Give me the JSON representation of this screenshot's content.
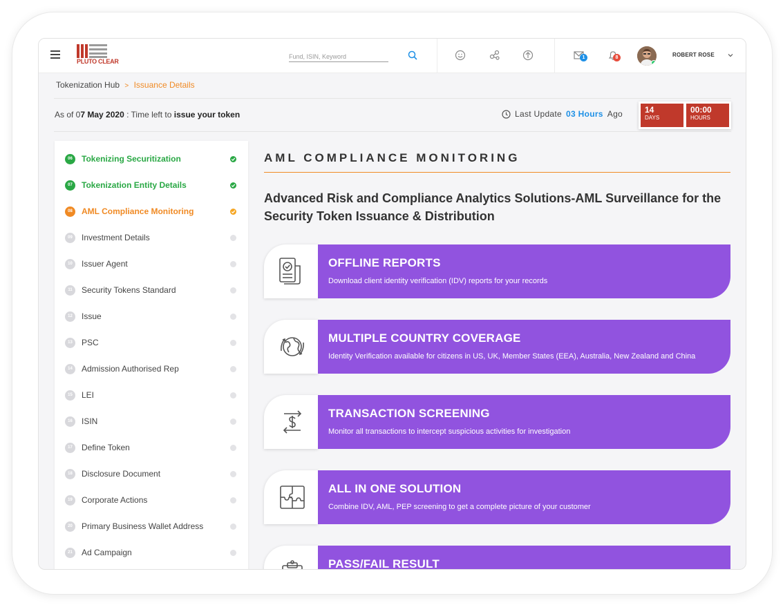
{
  "header": {
    "logo_text": "PLUTO CLEAR",
    "search_placeholder": "Fund, ISIN, Keyword",
    "mail_badge": "1",
    "notification_badge": "8",
    "username": "ROBERT ROSE"
  },
  "breadcrumb": {
    "root": "Tokenization Hub",
    "separator": ">",
    "current": "Issuance Details"
  },
  "status": {
    "asof_prefix": "As of 0",
    "asof_date": "7 May 2020",
    "asof_middle": " : Time left to ",
    "asof_action": "issue your token",
    "last_update_label": "Last Update",
    "last_update_value": "03 Hours",
    "last_update_suffix": "Ago",
    "countdown": [
      {
        "value": "14",
        "unit": "DAYS"
      },
      {
        "value": "00:00",
        "unit": "HOURS"
      }
    ]
  },
  "sidebar": {
    "steps": [
      {
        "num": "06",
        "label": "Tokenizing Securitization",
        "state": "done"
      },
      {
        "num": "07",
        "label": "Tokenization Entity Details",
        "state": "done"
      },
      {
        "num": "08",
        "label": "AML Compliance Monitoring",
        "state": "current"
      },
      {
        "num": "09",
        "label": "Investment Details",
        "state": "pending"
      },
      {
        "num": "10",
        "label": "Issuer Agent",
        "state": "pending"
      },
      {
        "num": "11",
        "label": "Security Tokens Standard",
        "state": "pending"
      },
      {
        "num": "12",
        "label": "Issue",
        "state": "pending"
      },
      {
        "num": "13",
        "label": "PSC",
        "state": "pending"
      },
      {
        "num": "14",
        "label": "Admission Authorised Rep",
        "state": "pending"
      },
      {
        "num": "15",
        "label": "LEI",
        "state": "pending"
      },
      {
        "num": "16",
        "label": "ISIN",
        "state": "pending"
      },
      {
        "num": "17",
        "label": "Define Token",
        "state": "pending"
      },
      {
        "num": "18",
        "label": "Disclosure Document",
        "state": "pending"
      },
      {
        "num": "19",
        "label": "Corporate Actions",
        "state": "pending"
      },
      {
        "num": "20",
        "label": "Primary Business Wallet Address",
        "state": "pending"
      },
      {
        "num": "21",
        "label": "Ad Campaign",
        "state": "pending"
      }
    ]
  },
  "main": {
    "title": "AML COMPLIANCE MONITORING",
    "subtitle": "Advanced Risk and Compliance Analytics Solutions-AML Surveillance for the Security Token  Issuance & Distribution",
    "features": [
      {
        "icon": "report-document-icon",
        "title": "OFFLINE REPORTS",
        "desc": "Download client identity verification (IDV) reports for your records"
      },
      {
        "icon": "globe-icon",
        "title": "MULTIPLE COUNTRY COVERAGE",
        "desc": "Identity Verification available for citizens in US, UK, Member States (EEA), Australia, New Zealand and China"
      },
      {
        "icon": "dollar-exchange-icon",
        "title": "TRANSACTION SCREENING",
        "desc": "Monitor all transactions to intercept suspicious activities for investigation"
      },
      {
        "icon": "puzzle-icon",
        "title": "ALL IN ONE SOLUTION",
        "desc": "Combine IDV, AML, PEP screening to get a complete picture of your customer"
      },
      {
        "icon": "clipboard-icon",
        "title": "PASS/FAIL RESULT",
        "desc": ""
      }
    ]
  },
  "colors": {
    "accent_orange": "#f08a24",
    "done_green": "#2aa845",
    "feature_purple": "#9153df",
    "countdown_red": "#c0392b",
    "link_blue": "#1e90e6"
  }
}
